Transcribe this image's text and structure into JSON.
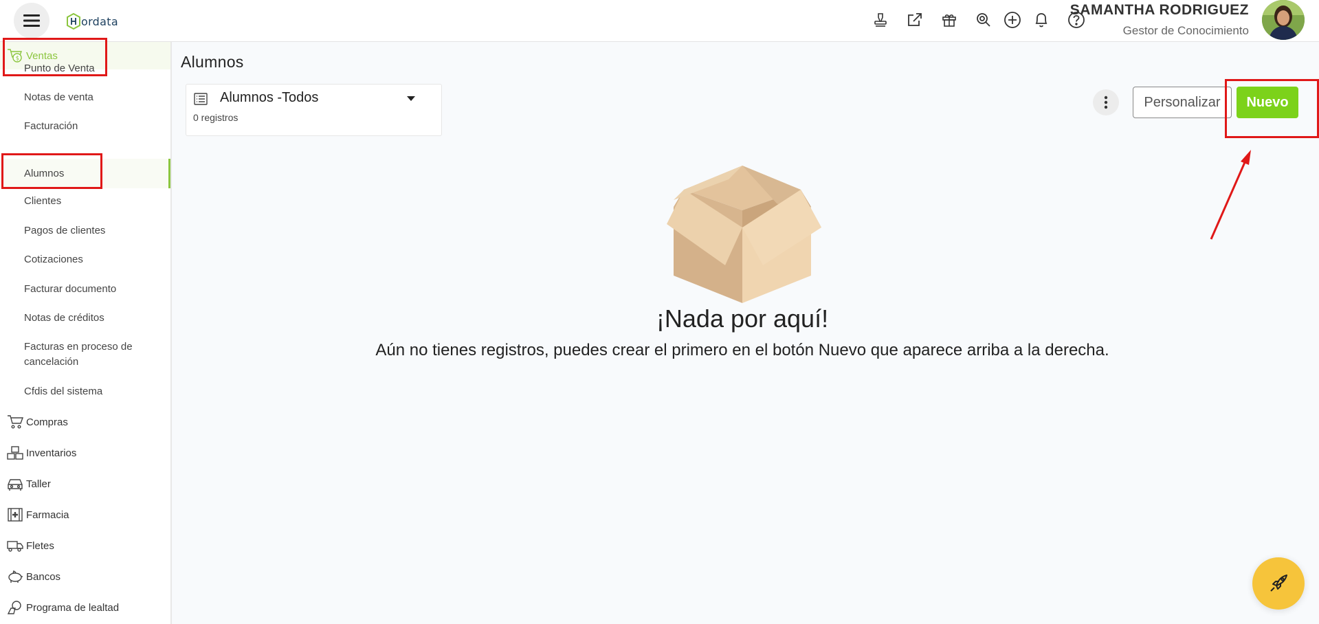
{
  "header": {
    "logo_text": "ordata",
    "user_name": "SAMANTHA RODRIGUEZ",
    "user_role": "Gestor de Conocimiento",
    "icons": [
      "stamp-icon",
      "external-link-icon",
      "gift-icon",
      "search-zoom-icon",
      "plus-circle-icon",
      "bell-icon",
      "help-icon"
    ]
  },
  "sidebar": {
    "ventas": {
      "label": "Ventas",
      "icon": "cart-money-icon",
      "items": [
        {
          "label": "Punto de Venta"
        },
        {
          "label": "Notas de venta"
        },
        {
          "label": "Facturación"
        },
        {
          "label": "Alumnos"
        },
        {
          "label": "Clientes"
        },
        {
          "label": "Pagos de clientes"
        },
        {
          "label": "Cotizaciones"
        },
        {
          "label": "Facturar documento"
        },
        {
          "label": "Notas de créditos"
        },
        {
          "label": "Facturas en proceso de cancelación"
        },
        {
          "label": "Cfdis del sistema"
        }
      ]
    },
    "sections": [
      {
        "label": "Compras",
        "icon": "cart-icon"
      },
      {
        "label": "Inventarios",
        "icon": "boxes-icon"
      },
      {
        "label": "Taller",
        "icon": "car-icon"
      },
      {
        "label": "Farmacia",
        "icon": "medical-kit-icon"
      },
      {
        "label": "Fletes",
        "icon": "truck-icon"
      },
      {
        "label": "Bancos",
        "icon": "piggy-bank-icon"
      },
      {
        "label": "Programa de lealtad",
        "icon": "loyalty-icon"
      }
    ]
  },
  "main": {
    "title": "Alumnos",
    "view": {
      "name": "Alumnos -Todos",
      "count": "0 registros"
    },
    "buttons": {
      "personalizar": "Personalizar",
      "nuevo": "Nuevo"
    },
    "empty": {
      "title": "¡Nada por aquí!",
      "subtitle": "Aún no tienes registros, puedes crear el primero en el botón Nuevo que aparece arriba a la derecha."
    }
  },
  "colors": {
    "accent": "#8cc63f",
    "nuevo_button": "#7cd21a",
    "fab": "#f6c43b",
    "annotation": "#e01818"
  }
}
